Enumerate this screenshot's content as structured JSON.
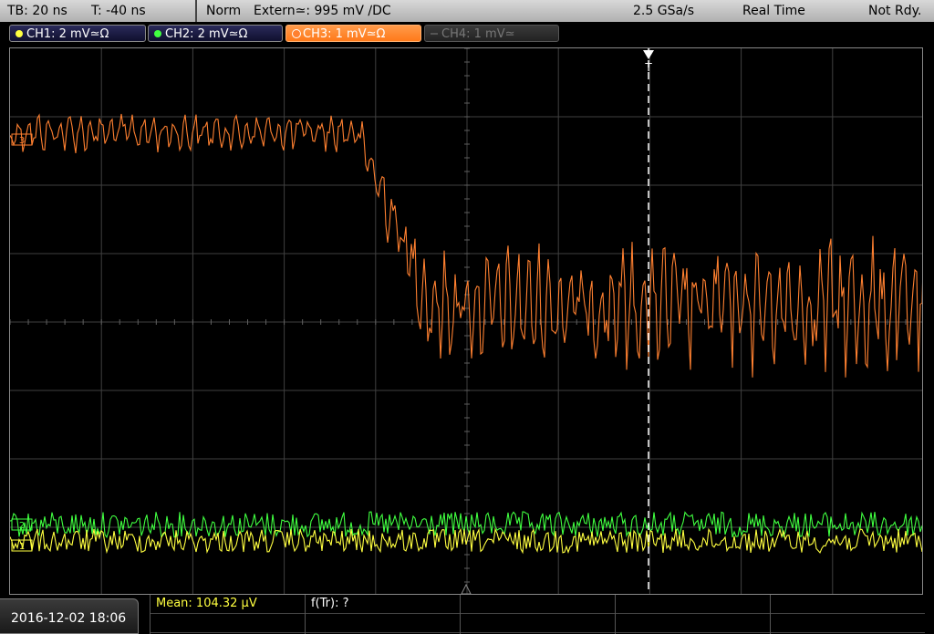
{
  "topbar": {
    "timebase": "TB: 20 ns",
    "trigger_time": "T: -40 ns",
    "mode": "Norm",
    "trigger_source": "Extern≃: 995 mV ∕DC",
    "sample_rate": "2.5 GSa/s",
    "acq_mode": "Real Time",
    "status": "Not Rdy."
  },
  "channels": [
    {
      "label": "CH1: 2 mV≃Ω",
      "color": "#ffff40",
      "state": "on"
    },
    {
      "label": "CH2: 2 mV≃Ω",
      "color": "#40ff40",
      "state": "on"
    },
    {
      "label": "CH3: 1 mV≃Ω",
      "color": "#ff8030",
      "state": "active"
    },
    {
      "label": "CH4: 1 mV≃",
      "color": "#777777",
      "state": "off"
    }
  ],
  "markers": {
    "trigger": "T",
    "ch3_level": "3",
    "ch2_level": "2",
    "ch1_level": "1"
  },
  "bottom": {
    "datetime": "2016-12-02 18:06",
    "meas1": "Mean: 104.32 µV",
    "meas2": "f(Tr): ?",
    "meas1_color": "#ffff40"
  },
  "colors": {
    "ch1": "#ffff40",
    "ch2": "#40ff40",
    "ch3": "#ff8030",
    "grid": "#404040"
  }
}
